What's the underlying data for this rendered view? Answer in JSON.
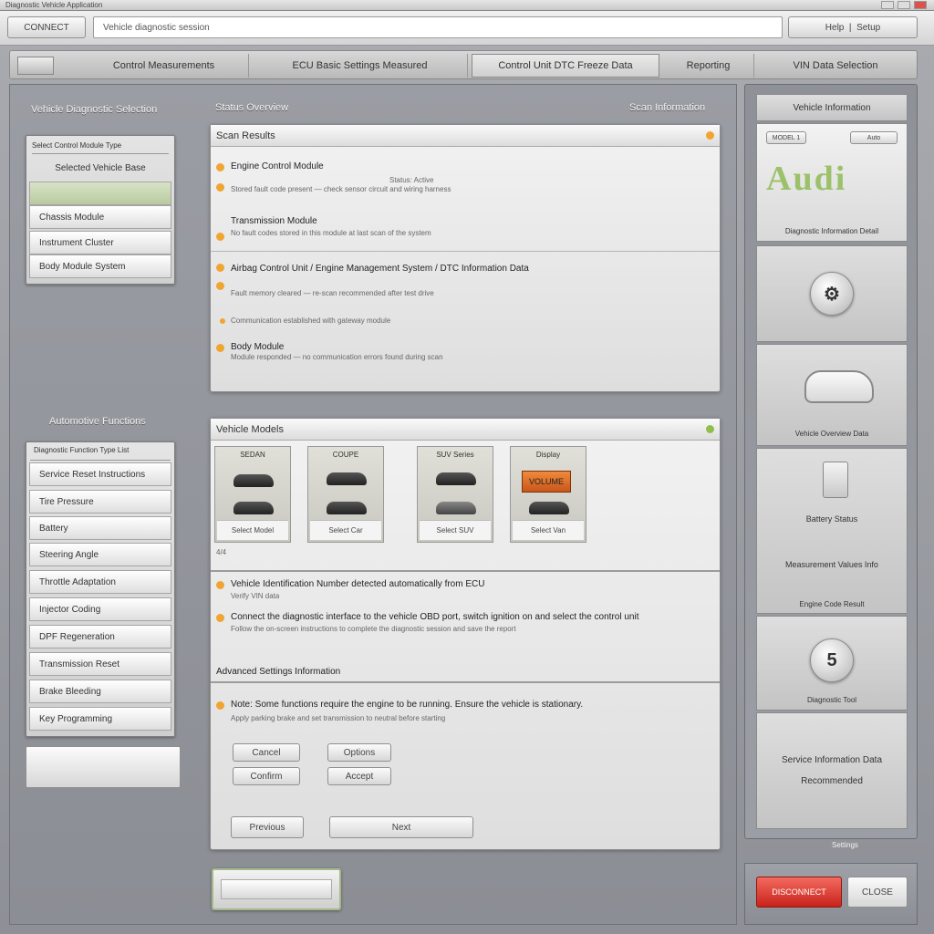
{
  "window": {
    "title": "Diagnostic Vehicle Application"
  },
  "toolbar": {
    "home_label": "CONNECT",
    "address_value": "Vehicle diagnostic session",
    "right_label": "Help",
    "right_sub": "Setup"
  },
  "tabs": [
    {
      "label": "Control Measurements"
    },
    {
      "label": "ECU Basic Settings Measured"
    },
    {
      "label": "Control Unit DTC Freeze Data"
    },
    {
      "label": "Reporting"
    },
    {
      "label": "VIN Data Selection"
    }
  ],
  "left": {
    "section1_title": "Vehicle Diagnostic Selection",
    "list1_header": "Select Control Module Type",
    "list1_sub": "Selected Vehicle Base",
    "list1_items": [
      "Chassis Module",
      "Instrument Cluster",
      "Body Module System"
    ],
    "section2_title": "Automotive Functions",
    "list2_header": "Diagnostic Function Type List",
    "list2_items": [
      "Service Reset Instructions",
      "Tire Pressure",
      "Battery",
      "Steering Angle",
      "Throttle Adaptation",
      "Injector Coding",
      "DPF Regeneration",
      "Transmission Reset",
      "Brake Bleeding",
      "Key Programming"
    ],
    "blank_button": ""
  },
  "main": {
    "top_title": "Status Overview",
    "top_right": "Scan Information",
    "card1": {
      "header": "Scan Results",
      "rows": [
        {
          "title": "Engine Control Module",
          "sub": "Stored fault code present — check sensor circuit and wiring harness",
          "extra": "Status: Active"
        },
        {
          "title": "Transmission Module",
          "sub": "No fault codes stored in this module at last scan of the system"
        },
        {
          "title": "Airbag Control Unit / Engine Management System / DTC Information Data",
          "sub": "Fault memory cleared — re-scan recommended after test drive"
        },
        {
          "title": "",
          "sub": "Communication established with gateway module"
        },
        {
          "title": "Body Module",
          "sub": "Module responded — no communication errors found during scan"
        }
      ]
    },
    "card2": {
      "header": "Vehicle Models",
      "thumbs": [
        {
          "caption": "SEDAN",
          "foot": "Select Model"
        },
        {
          "caption": "COUPE",
          "foot": "Select Car"
        },
        {
          "caption": "SUV Series",
          "foot": "Select SUV"
        },
        {
          "caption": "Display",
          "foot": "Select Van",
          "badge": "VOLUME"
        }
      ],
      "count": "4/4",
      "rows": [
        {
          "title": "Vehicle Identification Number detected automatically from ECU",
          "sub": "Verify VIN data"
        },
        {
          "title": "Connect the diagnostic interface to the vehicle OBD port, switch ignition on and select the control unit",
          "sub": "Follow the on-screen instructions to complete the diagnostic session and save the report"
        }
      ],
      "subsection": "Advanced Settings Information",
      "notice": "Note: Some functions require the engine to be running. Ensure the vehicle is stationary.",
      "notice_sub": "Apply parking brake and set transmission to neutral before starting",
      "btns": [
        "Cancel",
        "Options",
        "Confirm",
        "Accept"
      ],
      "footer_btns": [
        "Previous",
        "Next"
      ]
    },
    "bottom_button": ""
  },
  "right": {
    "header": "Vehicle Information",
    "badge1": "MODEL 1",
    "badge2": "Auto",
    "logo_text": "Audi",
    "info_label": "Diagnostic Information Detail",
    "cells": [
      {
        "label": "Diagnostic Tool"
      },
      {
        "label": "Vehicle Overview Data"
      },
      {
        "label": "Battery Status",
        "sub": "Measurement Values Info"
      },
      {
        "label": "Engine Code Result"
      },
      {
        "label": "Service Information Data",
        "sub": "Recommended"
      }
    ],
    "footer_text": "Settings",
    "btn_red": "DISCONNECT",
    "btn_gray": "CLOSE"
  },
  "colors": {
    "accent_orange": "#f0a530",
    "accent_green": "#8fbf4a",
    "alert_red": "#d9342a"
  }
}
